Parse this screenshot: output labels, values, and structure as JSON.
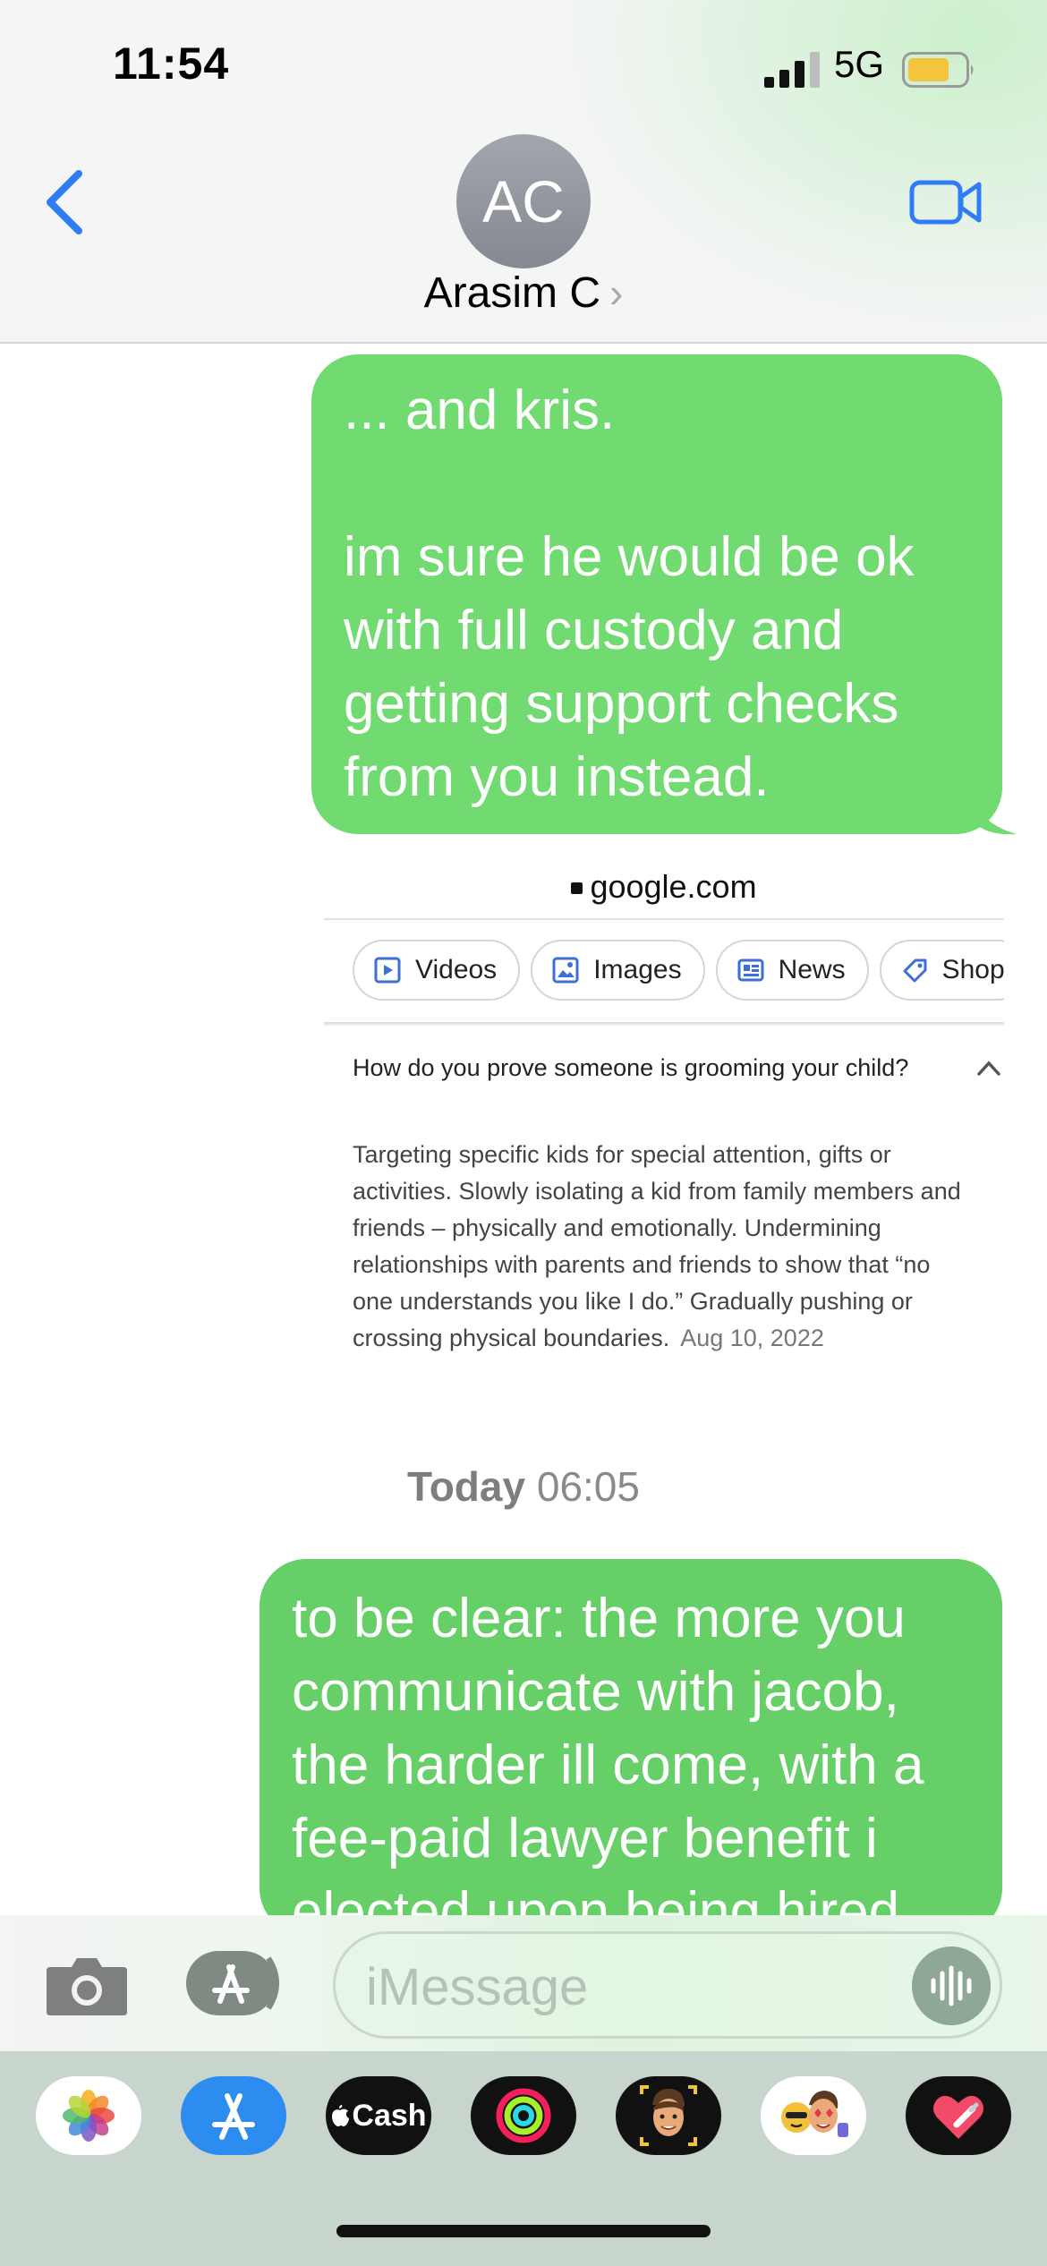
{
  "status_bar": {
    "time": "11:54",
    "network": "5G"
  },
  "header": {
    "avatar_initials": "AC",
    "contact_name": "Arasim C",
    "chevron": "›"
  },
  "messages": [
    {
      "lines": [
        "... and kris.",
        "",
        "im sure he would be ok",
        "with full custody and",
        "getting support checks",
        "from you instead."
      ]
    }
  ],
  "link_preview": {
    "domain": "google.com",
    "chips": [
      "Videos",
      "Images",
      "News",
      "Shop"
    ],
    "question": "How do you prove someone is grooming your child?",
    "answer_lines": [
      "Targeting specific kids for special attention, gifts or",
      "activities. Slowly isolating a kid from family members and",
      "friends – physically and emotionally. Undermining",
      "relationships with parents and friends to show that “no",
      "one understands you like I do.” Gradually pushing or",
      "crossing physical boundaries."
    ],
    "answer_date": "Aug 10, 2022"
  },
  "day_separator": {
    "day": "Today",
    "time": "06:05"
  },
  "message2": {
    "lines": [
      "to be clear: the more you",
      "communicate with jacob,",
      "the harder ill come, with a",
      "fee-paid lawyer benefit i",
      "elected upon being hired"
    ]
  },
  "composer": {
    "placeholder": "iMessage"
  },
  "app_drawer": {
    "cash_label": "Cash"
  },
  "colors": {
    "bubble": "#70d970",
    "accent": "#2f7cf6",
    "avatar": "#8f9299"
  }
}
